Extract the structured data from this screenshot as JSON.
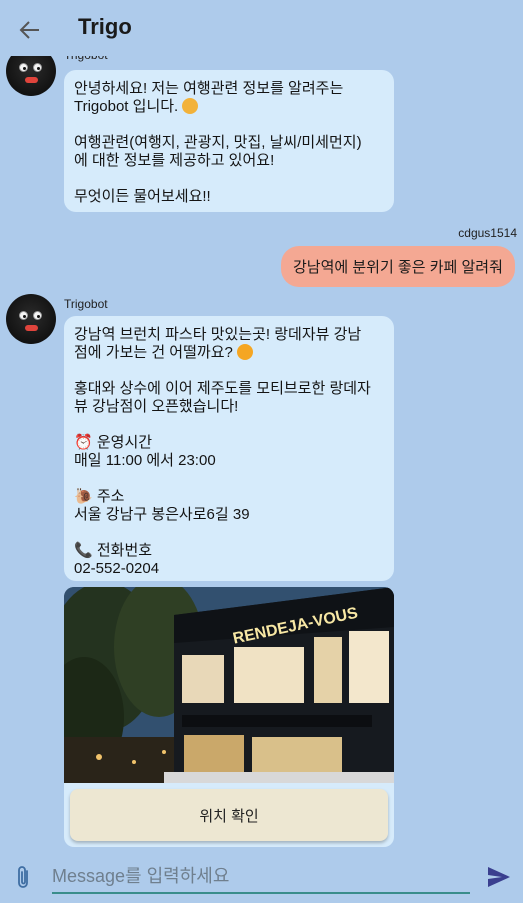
{
  "header": {
    "title": "Trigo"
  },
  "messages": {
    "bot1": {
      "sender": "Trigobot",
      "p1": "안녕하세요!  저는 여행관련 정보를 알려주는\nTrigobot 입니다.",
      "p2": "여행관련(여행지, 관광지, 맛집, 날씨/미세먼지)\n에 대한 정보를 제공하고 있어요!",
      "p3": "무엇이든 물어보세요!!"
    },
    "user1": {
      "sender": "cdgus1514",
      "text": "강남역에 분위기 좋은 카페 알려줘"
    },
    "bot2": {
      "sender": "Trigobot",
      "p1": "강남역 브런치 파스타 맛있는곳!  랑데자뷰 강남\n점에 가보는 건 어떨까요?",
      "p2": "홍대와 상수에 이어 제주도를 모티브로한 랑데자\n뷰 강남점이 오픈했습니다!",
      "hours_label": "운영시간",
      "hours_value": "매일 11:00  에서  23:00",
      "address_label": "주소",
      "address_value": "서울 강남구 봉은사로6길 39",
      "phone_label": "전화번호",
      "phone_value": "02-552-0204",
      "sign_text": "RENDEJA-VOUS",
      "location_button": "위치 확인"
    }
  },
  "composer": {
    "placeholder": "Message를 입력하세요"
  },
  "icons": {
    "back": "arrow-left-icon",
    "attach": "paperclip-icon",
    "send": "send-icon"
  },
  "colors": {
    "background": "#aecbeb",
    "bot_bubble": "#d6ebfb",
    "user_bubble": "#f4a893",
    "input_underline": "#3a8d8b",
    "send_icon": "#3a3f8f"
  }
}
